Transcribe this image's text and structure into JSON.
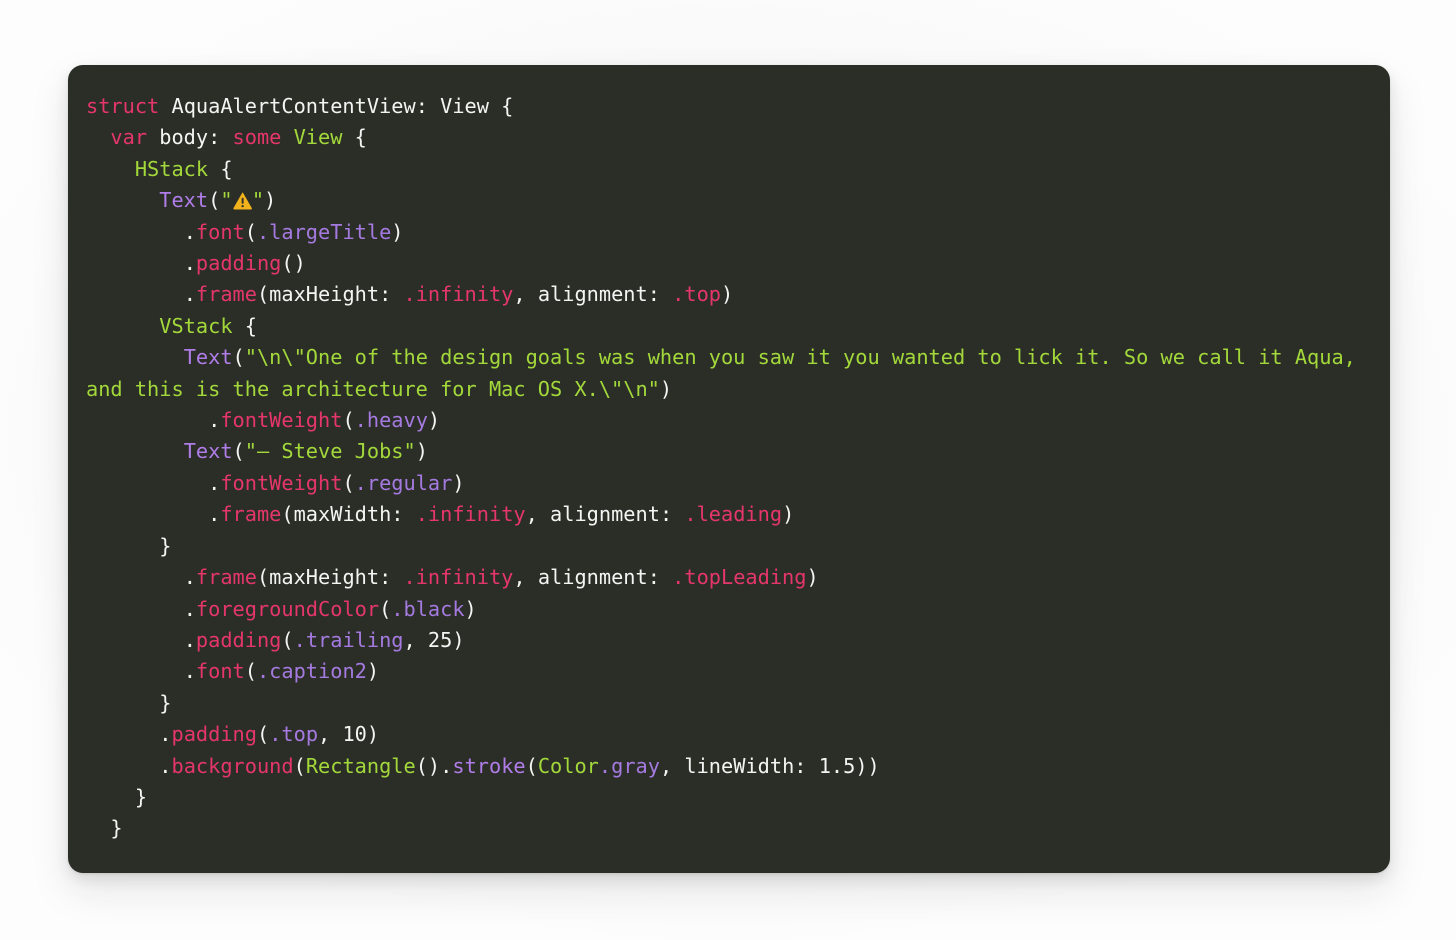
{
  "page": {
    "background_color": "#fbfbfb",
    "card_background_color": "#2b2e27",
    "card_corner_radius_px": 15
  },
  "theme": {
    "name": "dark-code-theme",
    "colors": {
      "background": "#2b2e27",
      "plain_text": "#f4f4f2",
      "keyword": "#e5366a",
      "type": "#a3d83b",
      "string": "#a3d83b",
      "function": "#e5366a",
      "member": "#a57ae0",
      "call": "#b07de8",
      "enum_case": "#e5366a",
      "emoji_warning_fill": "#f2b21c",
      "emoji_warning_mark": "#33312e"
    }
  },
  "code": {
    "language": "swift",
    "filename_hint": "AquaAlertContentView",
    "emoji_literal": "warning-sign-emoji",
    "lines": [
      {
        "indent": 0,
        "tokens": [
          {
            "t": "struct ",
            "c": "keyword"
          },
          {
            "t": "AquaAlertContentView: View {",
            "c": "plain"
          }
        ]
      },
      {
        "indent": 1,
        "tokens": [
          {
            "t": "var ",
            "c": "keyword"
          },
          {
            "t": "body: ",
            "c": "plain"
          },
          {
            "t": "some ",
            "c": "keyword"
          },
          {
            "t": "View",
            "c": "type"
          },
          {
            "t": " {",
            "c": "plain"
          }
        ]
      },
      {
        "indent": 2,
        "tokens": [
          {
            "t": "HStack",
            "c": "type"
          },
          {
            "t": " {",
            "c": "plain"
          }
        ]
      },
      {
        "indent": 3,
        "tokens": [
          {
            "t": "Text",
            "c": "call"
          },
          {
            "t": "(",
            "c": "plain"
          },
          {
            "t": "\"",
            "c": "string"
          },
          {
            "t": "@EMOJI_WARNING@",
            "c": "emoji"
          },
          {
            "t": "\"",
            "c": "string"
          },
          {
            "t": ")",
            "c": "plain"
          }
        ]
      },
      {
        "indent": 4,
        "tokens": [
          {
            "t": ".",
            "c": "plain"
          },
          {
            "t": "font",
            "c": "func"
          },
          {
            "t": "(",
            "c": "plain"
          },
          {
            "t": ".largeTitle",
            "c": "member"
          },
          {
            "t": ")",
            "c": "plain"
          }
        ]
      },
      {
        "indent": 4,
        "tokens": [
          {
            "t": ".",
            "c": "plain"
          },
          {
            "t": "padding",
            "c": "func"
          },
          {
            "t": "()",
            "c": "plain"
          }
        ]
      },
      {
        "indent": 4,
        "tokens": [
          {
            "t": ".",
            "c": "plain"
          },
          {
            "t": "frame",
            "c": "func"
          },
          {
            "t": "(maxHeight: ",
            "c": "plain"
          },
          {
            "t": ".infinity",
            "c": "enum"
          },
          {
            "t": ", alignment: ",
            "c": "plain"
          },
          {
            "t": ".top",
            "c": "enum"
          },
          {
            "t": ")",
            "c": "plain"
          }
        ]
      },
      {
        "indent": 3,
        "tokens": [
          {
            "t": "VStack",
            "c": "type"
          },
          {
            "t": " {",
            "c": "plain"
          }
        ]
      },
      {
        "indent": 4,
        "tokens": [
          {
            "t": "Text",
            "c": "call"
          },
          {
            "t": "(",
            "c": "plain"
          },
          {
            "t": "\"\\n\\\"One of the design goals was when you saw it you wanted to lick it. So we call it Aqua, and this is the architecture for Mac OS X.\\\"\\n\"",
            "c": "string"
          },
          {
            "t": ")",
            "c": "plain"
          }
        ]
      },
      {
        "indent": 5,
        "tokens": [
          {
            "t": ".",
            "c": "plain"
          },
          {
            "t": "fontWeight",
            "c": "func"
          },
          {
            "t": "(",
            "c": "plain"
          },
          {
            "t": ".heavy",
            "c": "member"
          },
          {
            "t": ")",
            "c": "plain"
          }
        ]
      },
      {
        "indent": 4,
        "tokens": [
          {
            "t": "Text",
            "c": "call"
          },
          {
            "t": "(",
            "c": "plain"
          },
          {
            "t": "\"– Steve Jobs\"",
            "c": "string"
          },
          {
            "t": ")",
            "c": "plain"
          }
        ]
      },
      {
        "indent": 5,
        "tokens": [
          {
            "t": ".",
            "c": "plain"
          },
          {
            "t": "fontWeight",
            "c": "func"
          },
          {
            "t": "(",
            "c": "plain"
          },
          {
            "t": ".regular",
            "c": "member"
          },
          {
            "t": ")",
            "c": "plain"
          }
        ]
      },
      {
        "indent": 5,
        "tokens": [
          {
            "t": ".",
            "c": "plain"
          },
          {
            "t": "frame",
            "c": "func"
          },
          {
            "t": "(maxWidth: ",
            "c": "plain"
          },
          {
            "t": ".infinity",
            "c": "enum"
          },
          {
            "t": ", alignment: ",
            "c": "plain"
          },
          {
            "t": ".leading",
            "c": "enum"
          },
          {
            "t": ")",
            "c": "plain"
          }
        ]
      },
      {
        "indent": 3,
        "tokens": [
          {
            "t": "}",
            "c": "plain"
          }
        ]
      },
      {
        "indent": 4,
        "tokens": [
          {
            "t": ".",
            "c": "plain"
          },
          {
            "t": "frame",
            "c": "func"
          },
          {
            "t": "(maxHeight: ",
            "c": "plain"
          },
          {
            "t": ".infinity",
            "c": "enum"
          },
          {
            "t": ", alignment: ",
            "c": "plain"
          },
          {
            "t": ".topLeading",
            "c": "enum"
          },
          {
            "t": ")",
            "c": "plain"
          }
        ]
      },
      {
        "indent": 4,
        "tokens": [
          {
            "t": ".",
            "c": "plain"
          },
          {
            "t": "foregroundColor",
            "c": "func"
          },
          {
            "t": "(",
            "c": "plain"
          },
          {
            "t": ".black",
            "c": "member"
          },
          {
            "t": ")",
            "c": "plain"
          }
        ]
      },
      {
        "indent": 4,
        "tokens": [
          {
            "t": ".",
            "c": "plain"
          },
          {
            "t": "padding",
            "c": "func"
          },
          {
            "t": "(",
            "c": "plain"
          },
          {
            "t": ".trailing",
            "c": "member"
          },
          {
            "t": ", 25)",
            "c": "plain"
          }
        ]
      },
      {
        "indent": 4,
        "tokens": [
          {
            "t": ".",
            "c": "plain"
          },
          {
            "t": "font",
            "c": "func"
          },
          {
            "t": "(",
            "c": "plain"
          },
          {
            "t": ".caption2",
            "c": "member"
          },
          {
            "t": ")",
            "c": "plain"
          }
        ]
      },
      {
        "indent": 3,
        "tokens": [
          {
            "t": "}",
            "c": "plain"
          }
        ]
      },
      {
        "indent": 3,
        "tokens": [
          {
            "t": ".",
            "c": "plain"
          },
          {
            "t": "padding",
            "c": "func"
          },
          {
            "t": "(",
            "c": "plain"
          },
          {
            "t": ".top",
            "c": "member"
          },
          {
            "t": ", 10)",
            "c": "plain"
          }
        ]
      },
      {
        "indent": 3,
        "tokens": [
          {
            "t": ".",
            "c": "plain"
          },
          {
            "t": "background",
            "c": "func"
          },
          {
            "t": "(",
            "c": "plain"
          },
          {
            "t": "Rectangle",
            "c": "type"
          },
          {
            "t": "().",
            "c": "plain"
          },
          {
            "t": "stroke",
            "c": "call"
          },
          {
            "t": "(",
            "c": "plain"
          },
          {
            "t": "Color",
            "c": "type"
          },
          {
            "t": ".gray",
            "c": "member"
          },
          {
            "t": ", lineWidth: 1.5))",
            "c": "plain"
          }
        ]
      },
      {
        "indent": 2,
        "tokens": [
          {
            "t": "}",
            "c": "plain"
          }
        ]
      },
      {
        "indent": 1,
        "tokens": [
          {
            "t": "}",
            "c": "plain"
          }
        ]
      }
    ]
  }
}
